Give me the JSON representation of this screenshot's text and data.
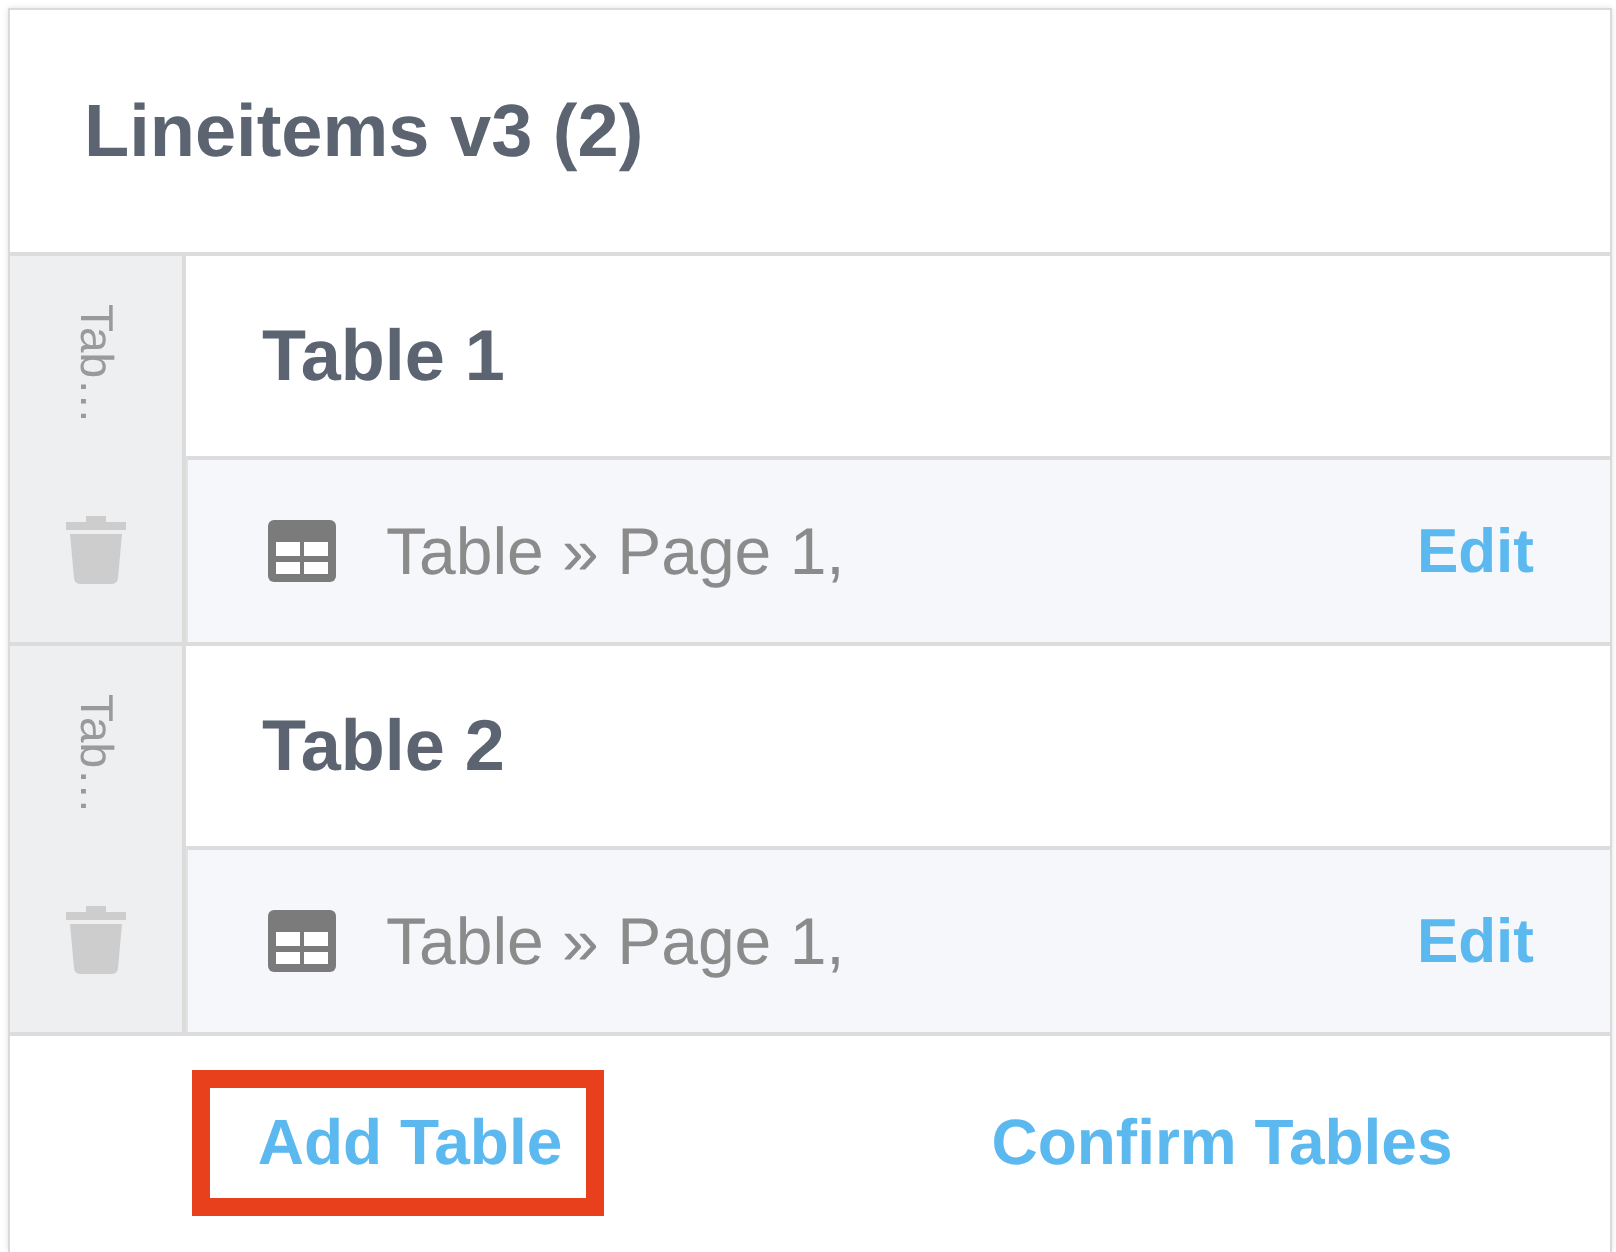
{
  "panel": {
    "title": "Lineitems v3 (2)"
  },
  "tables": [
    {
      "side_label": "Tab…",
      "name": "Table 1",
      "source": "Table » Page 1,",
      "action": "Edit"
    },
    {
      "side_label": "Tab…",
      "name": "Table 2",
      "source": "Table » Page 1,",
      "action": "Edit"
    }
  ],
  "footer": {
    "buttons": [
      {
        "label": "Add Table",
        "highlighted": true
      },
      {
        "label": "Confirm Tables",
        "highlighted": false
      }
    ]
  }
}
